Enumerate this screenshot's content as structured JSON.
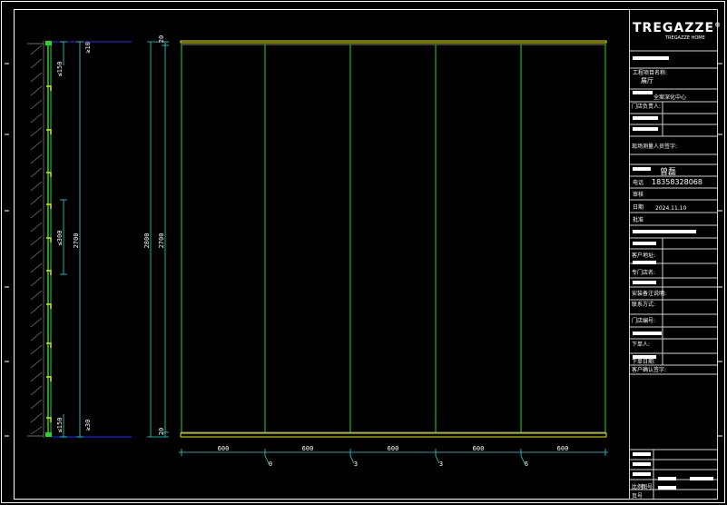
{
  "drawing": {
    "vertical_dims": {
      "top": "≥10",
      "top_inner": "≤150",
      "mid": "≤300",
      "overall_left": "2700",
      "bottom": "≥30",
      "bottom_inner": "≤150",
      "overall_2": "2800",
      "overall_3": "2700",
      "cap_top": "20",
      "cap_bottom": "20"
    },
    "horizontal_dims": [
      "600",
      "600",
      "600",
      "600",
      "600"
    ],
    "panel_tags": [
      "0",
      "3",
      "3",
      "6"
    ]
  },
  "title_block": {
    "brand": "TREGAZZE",
    "brand_mark": "®",
    "brand_sub": "TREGAZZE HOME",
    "project_label": "工程项目名称:",
    "project_value": "展厅",
    "center_label": "全案深化中心",
    "owner_label": "门店负责人:",
    "sign_label": "现场测量人员签字:",
    "designer_value": "曾磊",
    "phone_label": "电话",
    "phone_value": "18358328068",
    "audit_label": "审核",
    "date_label": "日期",
    "date_value": "2024.11.10",
    "approve_label": "批准",
    "address_label": "客户地址:",
    "factory_label": "专门店名:",
    "factory_no_label": "联系方式:",
    "remark_label": "安装备注说明:",
    "shop_label": "门店编号:",
    "orderer_label": "下单人:",
    "order_date_label": "下单日期:",
    "confirm_label": "客户确认签字:",
    "scale_label": "比例",
    "sheet_label": "图号",
    "page_label": "页号"
  }
}
